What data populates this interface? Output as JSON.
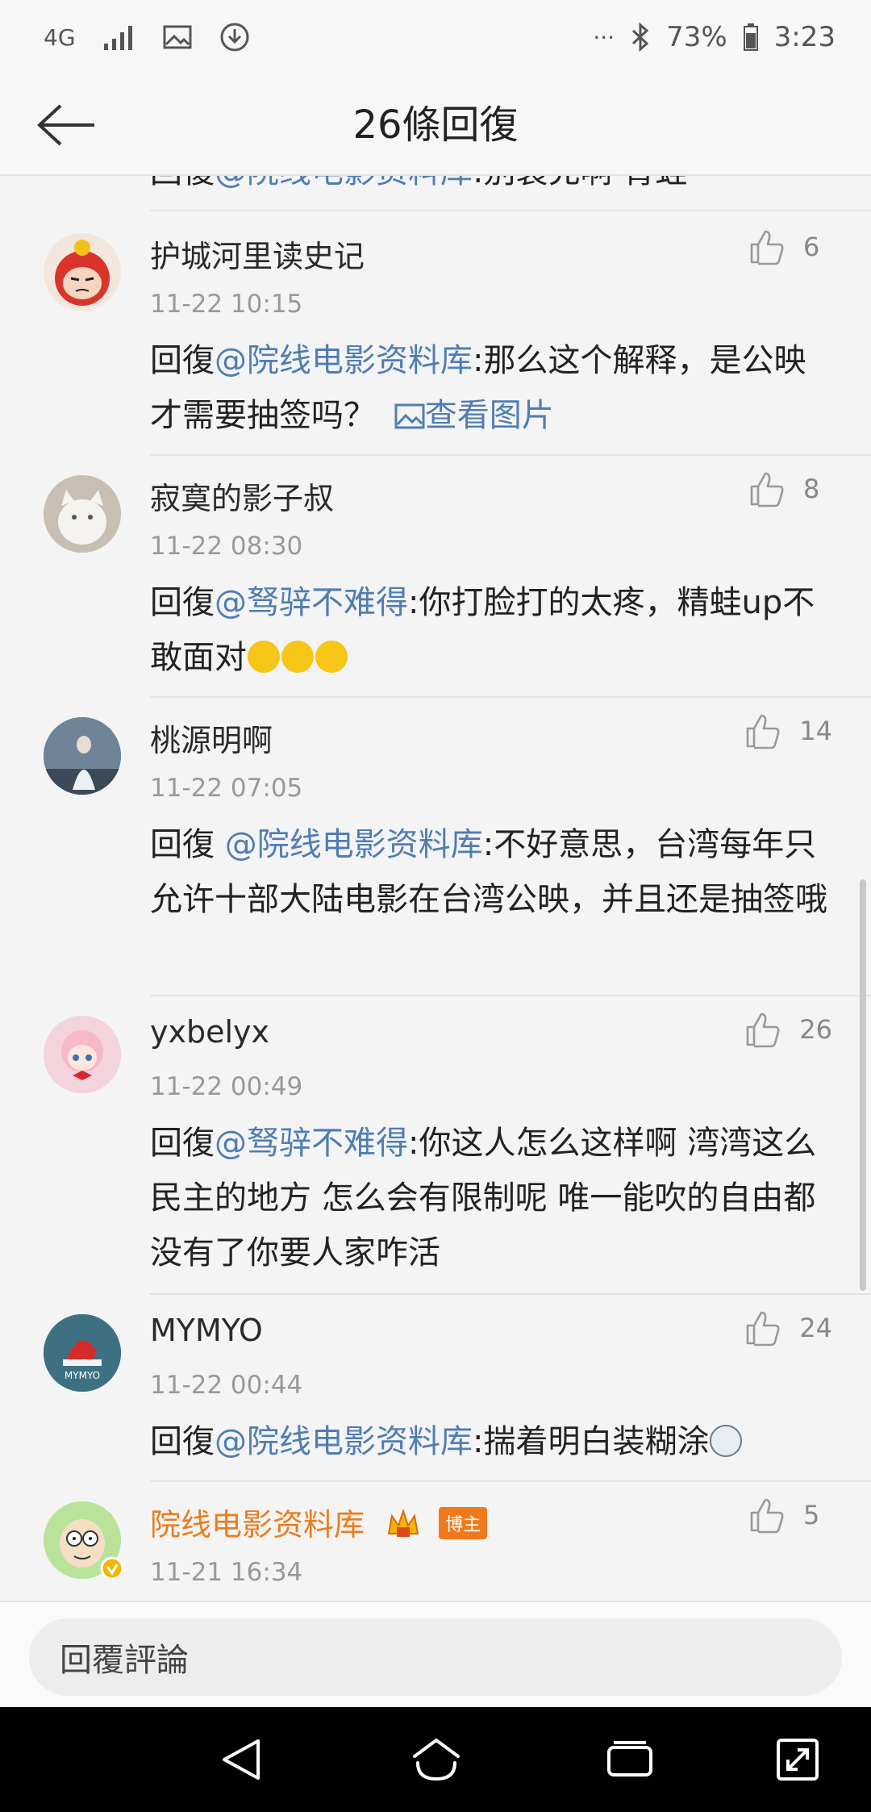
{
  "status_bar": {
    "network": "4G",
    "more": "···",
    "battery_percent": "73%",
    "time": "3:23",
    "icons": [
      "network-4g-icon",
      "signal-icon",
      "image-icon",
      "download-icon",
      "bluetooth-icon",
      "battery-icon"
    ]
  },
  "header": {
    "title": "26條回復",
    "back_icon": "arrow-left-icon"
  },
  "cut_reply": {
    "prefix": "回復",
    "mention": "@院线电影资料库",
    "text": ":别装充啊 青蛙"
  },
  "replies": [
    {
      "username": "护城河里读史记",
      "time": "11-22 10:15",
      "likes": "6",
      "prefix": "回復",
      "mention": "@院线电影资料库",
      "text": ":那么这个解释，是公映才需要抽签吗？",
      "image_link": "查看图片"
    },
    {
      "username": "寂寞的影子叔",
      "time": "11-22 08:30",
      "likes": "8",
      "prefix": "回復",
      "mention": "@驽骍不难得",
      "text": ":你打脸打的太疼，精蛙up不敢面对",
      "emoji": "crying-laughing-emoji"
    },
    {
      "username": "桃源明啊",
      "time": "11-22 07:05",
      "likes": "14",
      "prefix": "回復 ",
      "mention": "@院线电影资料库",
      "text": ":不好意思，台湾每年只允许十部大陆电影在台湾公映，并且还是抽签哦"
    },
    {
      "username": "yxbelyx",
      "time": "11-22 00:49",
      "likes": "26",
      "prefix": "回復",
      "mention": "@驽骍不难得",
      "text": ":你这人怎么这样啊 湾湾这么民主的地方 怎么会有限制呢 唯一能吹的自由都没有了你要人家咋活"
    },
    {
      "username": "MYMYO",
      "time": "11-22 00:44",
      "likes": "24",
      "prefix": "回復",
      "mention": "@院线电影资料库",
      "text": ":揣着明白装糊涂",
      "emoji": "husky-emoji"
    },
    {
      "username": "院线电影资料库",
      "time": "11-21 16:34",
      "likes": "5",
      "badge": "博主",
      "crown_icon": "vip-crown-icon",
      "verified_icon": "verified-v-icon"
    }
  ],
  "input": {
    "placeholder": "回覆評論"
  },
  "nav": {
    "icons": [
      "nav-back-icon",
      "nav-home-icon",
      "nav-recents-icon",
      "nav-expand-icon"
    ]
  },
  "colors": {
    "mention": "#4f7db3",
    "blogger_name": "#ea7d1e",
    "badge": "#f07a1a",
    "background": "#f4f4f4"
  }
}
